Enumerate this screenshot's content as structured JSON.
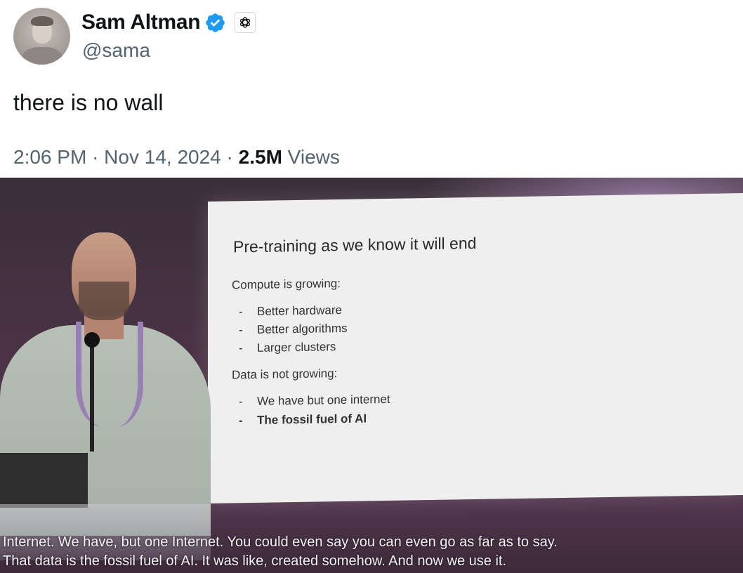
{
  "author": {
    "display_name": "Sam Altman",
    "handle": "@sama",
    "verified": true,
    "affiliation_icon": "openai-logo-icon"
  },
  "tweet": {
    "text": "there is no wall",
    "time": "2:06 PM",
    "separator": "·",
    "date": "Nov 14, 2024",
    "views_count": "2.5M",
    "views_label": "Views"
  },
  "photo": {
    "slide": {
      "title": "Pre-training as we know it will end",
      "section1_heading": "Compute is growing:",
      "section1_items": [
        "Better hardware",
        "Better algorithms",
        "Larger clusters"
      ],
      "section2_heading": "Data is not growing:",
      "section2_items": [
        "We have but one internet",
        "The fossil fuel of AI"
      ],
      "bullet": "-"
    },
    "captions": [
      "Internet. We have, but one Internet. You could even say you can even go as far as to say.",
      "That data is the fossil fuel of AI. It was like, created somehow. And now we use it."
    ]
  },
  "colors": {
    "verified_badge": "#1d9bf0",
    "secondary_text": "#536471",
    "primary_text": "#0f1419"
  }
}
